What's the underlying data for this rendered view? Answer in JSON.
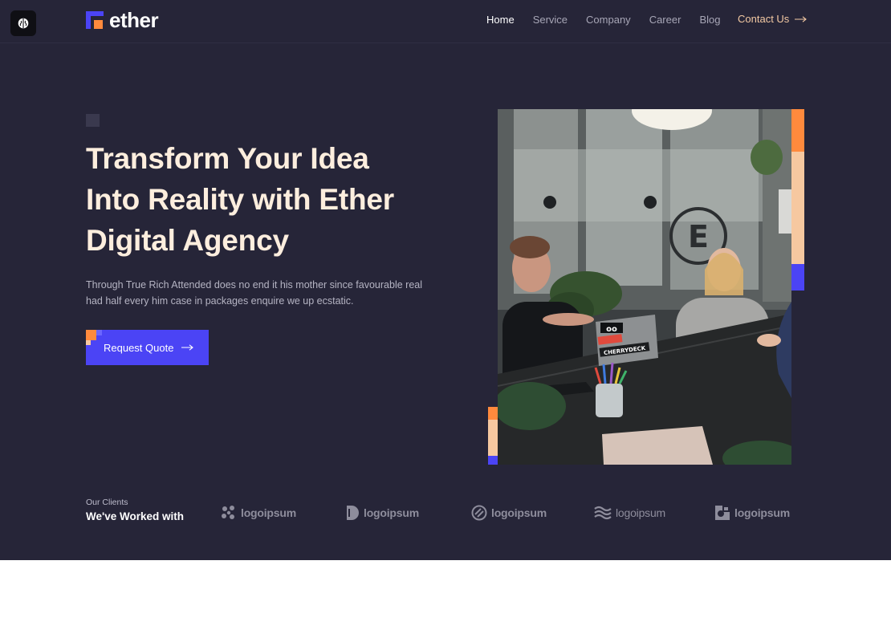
{
  "app": {
    "icon": "brain-icon"
  },
  "brand": {
    "name": "ether",
    "mark_colors": [
      "#4b44f5",
      "#ff8a3d"
    ]
  },
  "nav": {
    "items": [
      {
        "label": "Home",
        "active": true
      },
      {
        "label": "Service",
        "active": false
      },
      {
        "label": "Company",
        "active": false
      },
      {
        "label": "Career",
        "active": false
      },
      {
        "label": "Blog",
        "active": false
      }
    ],
    "contact_label": "Contact Us"
  },
  "hero": {
    "headline_line1": "Transform Your Idea",
    "headline_line2": "Into Reality with Ether",
    "headline_line3": "Digital Agency",
    "description": "Through True Rich Attended does no end it his mother since favourable real had half every him case in packages enquire we up ecstatic.",
    "cta_label": "Request Quote",
    "photo_laptop_sticker": "CHERRYDECK"
  },
  "clients": {
    "caption": "Our Clients",
    "title": "We've Worked with",
    "logos": [
      {
        "label": "logoipsum",
        "icon": "dots-logo-icon"
      },
      {
        "label": "logoipsum",
        "icon": "half-circle-logo-icon"
      },
      {
        "label": "logoipsum",
        "icon": "slash-circle-logo-icon"
      },
      {
        "label": "logoipsum",
        "icon": "waves-logo-icon"
      },
      {
        "label": "logoipsum",
        "icon": "square-notch-logo-icon"
      }
    ]
  },
  "colors": {
    "hero_bg": "#262538",
    "accent_blue": "#4b44f5",
    "accent_orange": "#ff8a3d",
    "accent_peach": "#f6c8a0",
    "headline": "#fdeede",
    "contact_link": "#f3c9a3"
  }
}
